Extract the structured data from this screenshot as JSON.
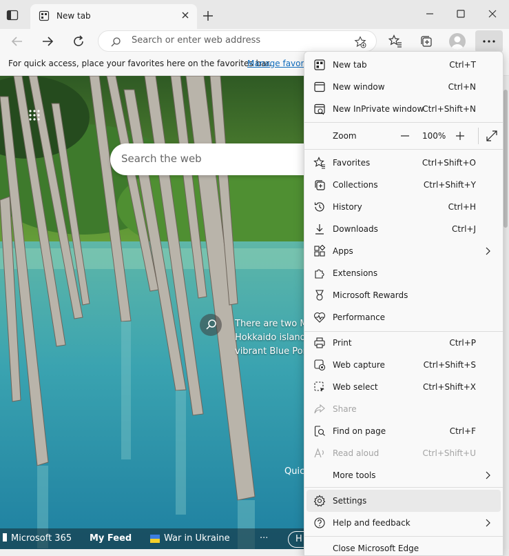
{
  "tab": {
    "title": "New tab"
  },
  "address_bar": {
    "placeholder": "Search or enter web address"
  },
  "favorites_bar": {
    "text": "For quick access, place your favorites here on the favorites bar.",
    "link": "Manage favorites now"
  },
  "ntp": {
    "search_placeholder": "Search the web",
    "caption_lines": [
      "There are two M",
      "Hokkaido island",
      "vibrant Blue Pon"
    ],
    "quick_label": "Quick links",
    "strip": {
      "m365": "Microsoft 365",
      "feed": "My Feed",
      "ukraine": "War in Ukraine",
      "more": "···",
      "pill": "H"
    }
  },
  "menu": {
    "items": [
      {
        "label": "New tab",
        "shortcut": "Ctrl+T",
        "icon": "new-tab-icon"
      },
      {
        "label": "New window",
        "shortcut": "Ctrl+N",
        "icon": "window-icon"
      },
      {
        "label": "New InPrivate window",
        "shortcut": "Ctrl+Shift+N",
        "icon": "inprivate-icon"
      },
      {
        "label": "Favorites",
        "shortcut": "Ctrl+Shift+O",
        "icon": "favorites-icon"
      },
      {
        "label": "Collections",
        "shortcut": "Ctrl+Shift+Y",
        "icon": "collections-icon"
      },
      {
        "label": "History",
        "shortcut": "Ctrl+H",
        "icon": "history-icon"
      },
      {
        "label": "Downloads",
        "shortcut": "Ctrl+J",
        "icon": "download-icon"
      },
      {
        "label": "Apps",
        "shortcut": "",
        "icon": "apps-icon"
      },
      {
        "label": "Extensions",
        "shortcut": "",
        "icon": "extensions-icon"
      },
      {
        "label": "Microsoft Rewards",
        "shortcut": "",
        "icon": "rewards-icon"
      },
      {
        "label": "Performance",
        "shortcut": "",
        "icon": "performance-icon"
      },
      {
        "label": "Print",
        "shortcut": "Ctrl+P",
        "icon": "print-icon"
      },
      {
        "label": "Web capture",
        "shortcut": "Ctrl+Shift+S",
        "icon": "web-capture-icon"
      },
      {
        "label": "Web select",
        "shortcut": "Ctrl+Shift+X",
        "icon": "web-select-icon"
      },
      {
        "label": "Share",
        "shortcut": "",
        "icon": "share-icon"
      },
      {
        "label": "Find on page",
        "shortcut": "Ctrl+F",
        "icon": "find-icon"
      },
      {
        "label": "Read aloud",
        "shortcut": "Ctrl+Shift+U",
        "icon": "read-aloud-icon"
      },
      {
        "label": "More tools",
        "shortcut": "",
        "icon": "more-tools-icon"
      },
      {
        "label": "Settings",
        "shortcut": "",
        "icon": "settings-icon"
      },
      {
        "label": "Help and feedback",
        "shortcut": "",
        "icon": "help-icon"
      },
      {
        "label": "Close Microsoft Edge",
        "shortcut": "",
        "icon": "close-edge-icon"
      }
    ],
    "zoom": {
      "label": "Zoom",
      "value": "100%"
    }
  }
}
